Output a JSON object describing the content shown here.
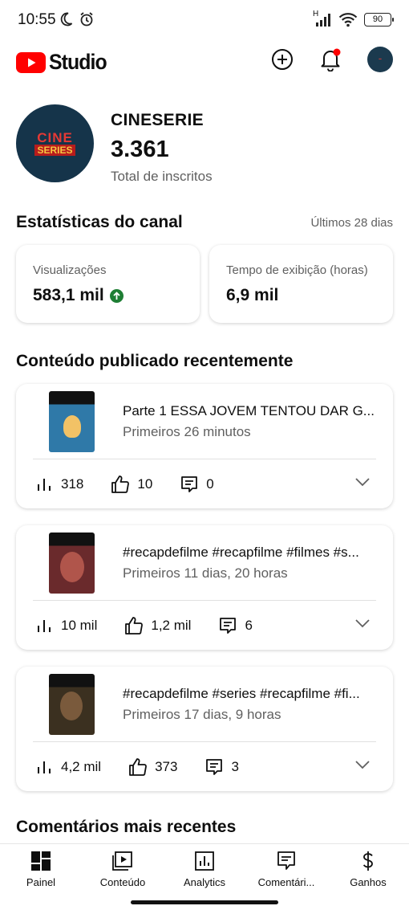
{
  "status_bar": {
    "time": "10:55",
    "network_label": "H",
    "battery": "90"
  },
  "app": {
    "brand": "Studio"
  },
  "channel": {
    "name": "CINESERIE",
    "avatar_line1": "CINE",
    "avatar_line2": "SERIES",
    "subscribers": "3.361",
    "subscribers_label": "Total de inscritos"
  },
  "stats": {
    "title": "Estatísticas do canal",
    "period": "Últimos 28 dias",
    "views_label": "Visualizações",
    "views_value": "583,1 mil",
    "watch_label": "Tempo de exibição (horas)",
    "watch_value": "6,9 mil"
  },
  "recent": {
    "title": "Conteúdo publicado recentemente",
    "videos": [
      {
        "title": "Parte 1 ESSA JOVEM TENTOU DAR G...",
        "meta": "Primeiros 26 minutos",
        "views": "318",
        "likes": "10",
        "comments": "0",
        "thumb_color": "#2f79a8"
      },
      {
        "title": "#recapdefilme #recapfilme #filmes #s...",
        "meta": "Primeiros 11 dias, 20 horas",
        "views": "10 mil",
        "likes": "1,2 mil",
        "comments": "6",
        "thumb_color": "#6a2a2c"
      },
      {
        "title": "#recapdefilme #series #recapfilme #fi...",
        "meta": "Primeiros 17 dias, 9 horas",
        "views": "4,2 mil",
        "likes": "373",
        "comments": "3",
        "thumb_color": "#3b3020"
      }
    ]
  },
  "comments_section": {
    "title": "Comentários mais recentes"
  },
  "bottom_nav": [
    {
      "label": "Painel",
      "icon": "dashboard-icon",
      "active": true
    },
    {
      "label": "Conteúdo",
      "icon": "content-icon"
    },
    {
      "label": "Analytics",
      "icon": "analytics-icon"
    },
    {
      "label": "Comentári...",
      "icon": "comments-icon"
    },
    {
      "label": "Ganhos",
      "icon": "earnings-icon"
    }
  ]
}
